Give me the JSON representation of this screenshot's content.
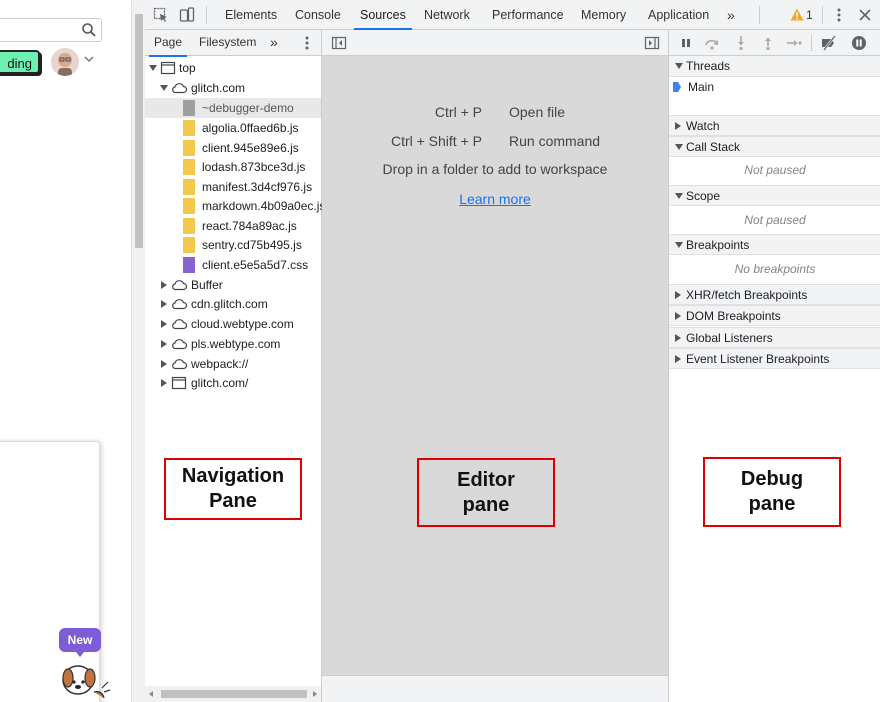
{
  "site": {
    "button_label": "ding",
    "new_badge": "New"
  },
  "devtools": {
    "tabs": [
      "Elements",
      "Console",
      "Sources",
      "Network",
      "Performance",
      "Memory",
      "Application"
    ],
    "more_tabs": "»",
    "warning_count": "1",
    "navigator": {
      "tabs": [
        "Page",
        "Filesystem"
      ],
      "more": "»",
      "tree": [
        {
          "label": "top",
          "icon": "frame-icon",
          "expanded": true
        },
        {
          "label": "glitch.com",
          "icon": "cloud-icon",
          "expanded": true
        },
        {
          "label": "~debugger-demo",
          "icon": "file-icon-grey",
          "selected": true
        },
        {
          "label": "algolia.0ffaed6b.js",
          "icon": "file-icon-js"
        },
        {
          "label": "client.945e89e6.js",
          "icon": "file-icon-js"
        },
        {
          "label": "lodash.873bce3d.js",
          "icon": "file-icon-js"
        },
        {
          "label": "manifest.3d4cf976.js",
          "icon": "file-icon-js"
        },
        {
          "label": "markdown.4b09a0ec.js",
          "icon": "file-icon-js"
        },
        {
          "label": "react.784a89ac.js",
          "icon": "file-icon-js"
        },
        {
          "label": "sentry.cd75b495.js",
          "icon": "file-icon-js"
        },
        {
          "label": "client.e5e5a5d7.css",
          "icon": "file-icon-css"
        },
        {
          "label": "Buffer",
          "icon": "cloud-icon",
          "expanded": false
        },
        {
          "label": "cdn.glitch.com",
          "icon": "cloud-icon",
          "expanded": false
        },
        {
          "label": "cloud.webtype.com",
          "icon": "cloud-icon",
          "expanded": false
        },
        {
          "label": "pls.webtype.com",
          "icon": "cloud-icon",
          "expanded": false
        },
        {
          "label": "webpack://",
          "icon": "cloud-icon",
          "expanded": false
        },
        {
          "label": "glitch.com/",
          "icon": "frame-icon",
          "expanded": false
        }
      ]
    },
    "editor": {
      "shortcuts": [
        {
          "keys": "Ctrl + P",
          "desc": "Open file"
        },
        {
          "keys": "Ctrl + Shift + P",
          "desc": "Run command"
        }
      ],
      "drop_text": "Drop in a folder to add to workspace",
      "learn_more": "Learn more"
    },
    "debugger": {
      "threads_header": "Threads",
      "thread_main": "Main",
      "sections": [
        {
          "label": "Watch",
          "expanded": false
        },
        {
          "label": "Call Stack",
          "expanded": true,
          "empty": "Not paused"
        },
        {
          "label": "Scope",
          "expanded": true,
          "empty": "Not paused"
        },
        {
          "label": "Breakpoints",
          "expanded": true,
          "empty": "No breakpoints"
        },
        {
          "label": "XHR/fetch Breakpoints",
          "expanded": false
        },
        {
          "label": "DOM Breakpoints",
          "expanded": false
        },
        {
          "label": "Global Listeners",
          "expanded": false
        },
        {
          "label": "Event Listener Breakpoints",
          "expanded": false
        }
      ]
    }
  },
  "annotations": {
    "navigation": "Navigation\nPane",
    "editor": "Editor\npane",
    "debug": "Debug\npane"
  },
  "colors": {
    "accent": "#1a73e8",
    "annotation_border": "#dd0000",
    "js_file": "#f2c94c",
    "css_file": "#8a63d2",
    "site_button": "#6ff0b0",
    "badge": "#7d5cd8"
  }
}
